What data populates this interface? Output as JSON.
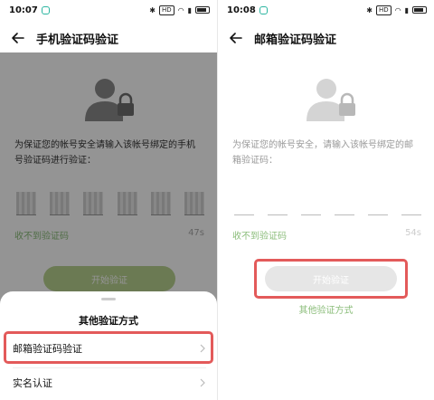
{
  "left": {
    "status": {
      "time": "10:07",
      "net": "HD",
      "battery_label": "▭"
    },
    "header": {
      "title": "手机验证码验证"
    },
    "description": "为保证您的帐号安全请输入该帐号绑定的手机号验证码进行验证：",
    "resend": {
      "label": "收不到验证码",
      "countdown": "47s"
    },
    "start_button": "开始验证",
    "sheet": {
      "title": "其他验证方式",
      "items": [
        {
          "label": "邮箱验证码验证"
        },
        {
          "label": "实名认证"
        }
      ]
    }
  },
  "right": {
    "status": {
      "time": "10:08",
      "net": "HD"
    },
    "header": {
      "title": "邮箱验证码验证"
    },
    "description": "为保证您的帐号安全，请输入该帐号绑定的邮箱验证码：",
    "resend": {
      "label": "收不到验证码",
      "countdown": "54s"
    },
    "start_button": "开始验证",
    "other_link": "其他验证方式"
  },
  "colors": {
    "accent_green": "#8bbd7a",
    "button_green": "#b9d28f",
    "button_disabled": "#e6e6e6",
    "highlight_red": "#e35a5a"
  }
}
